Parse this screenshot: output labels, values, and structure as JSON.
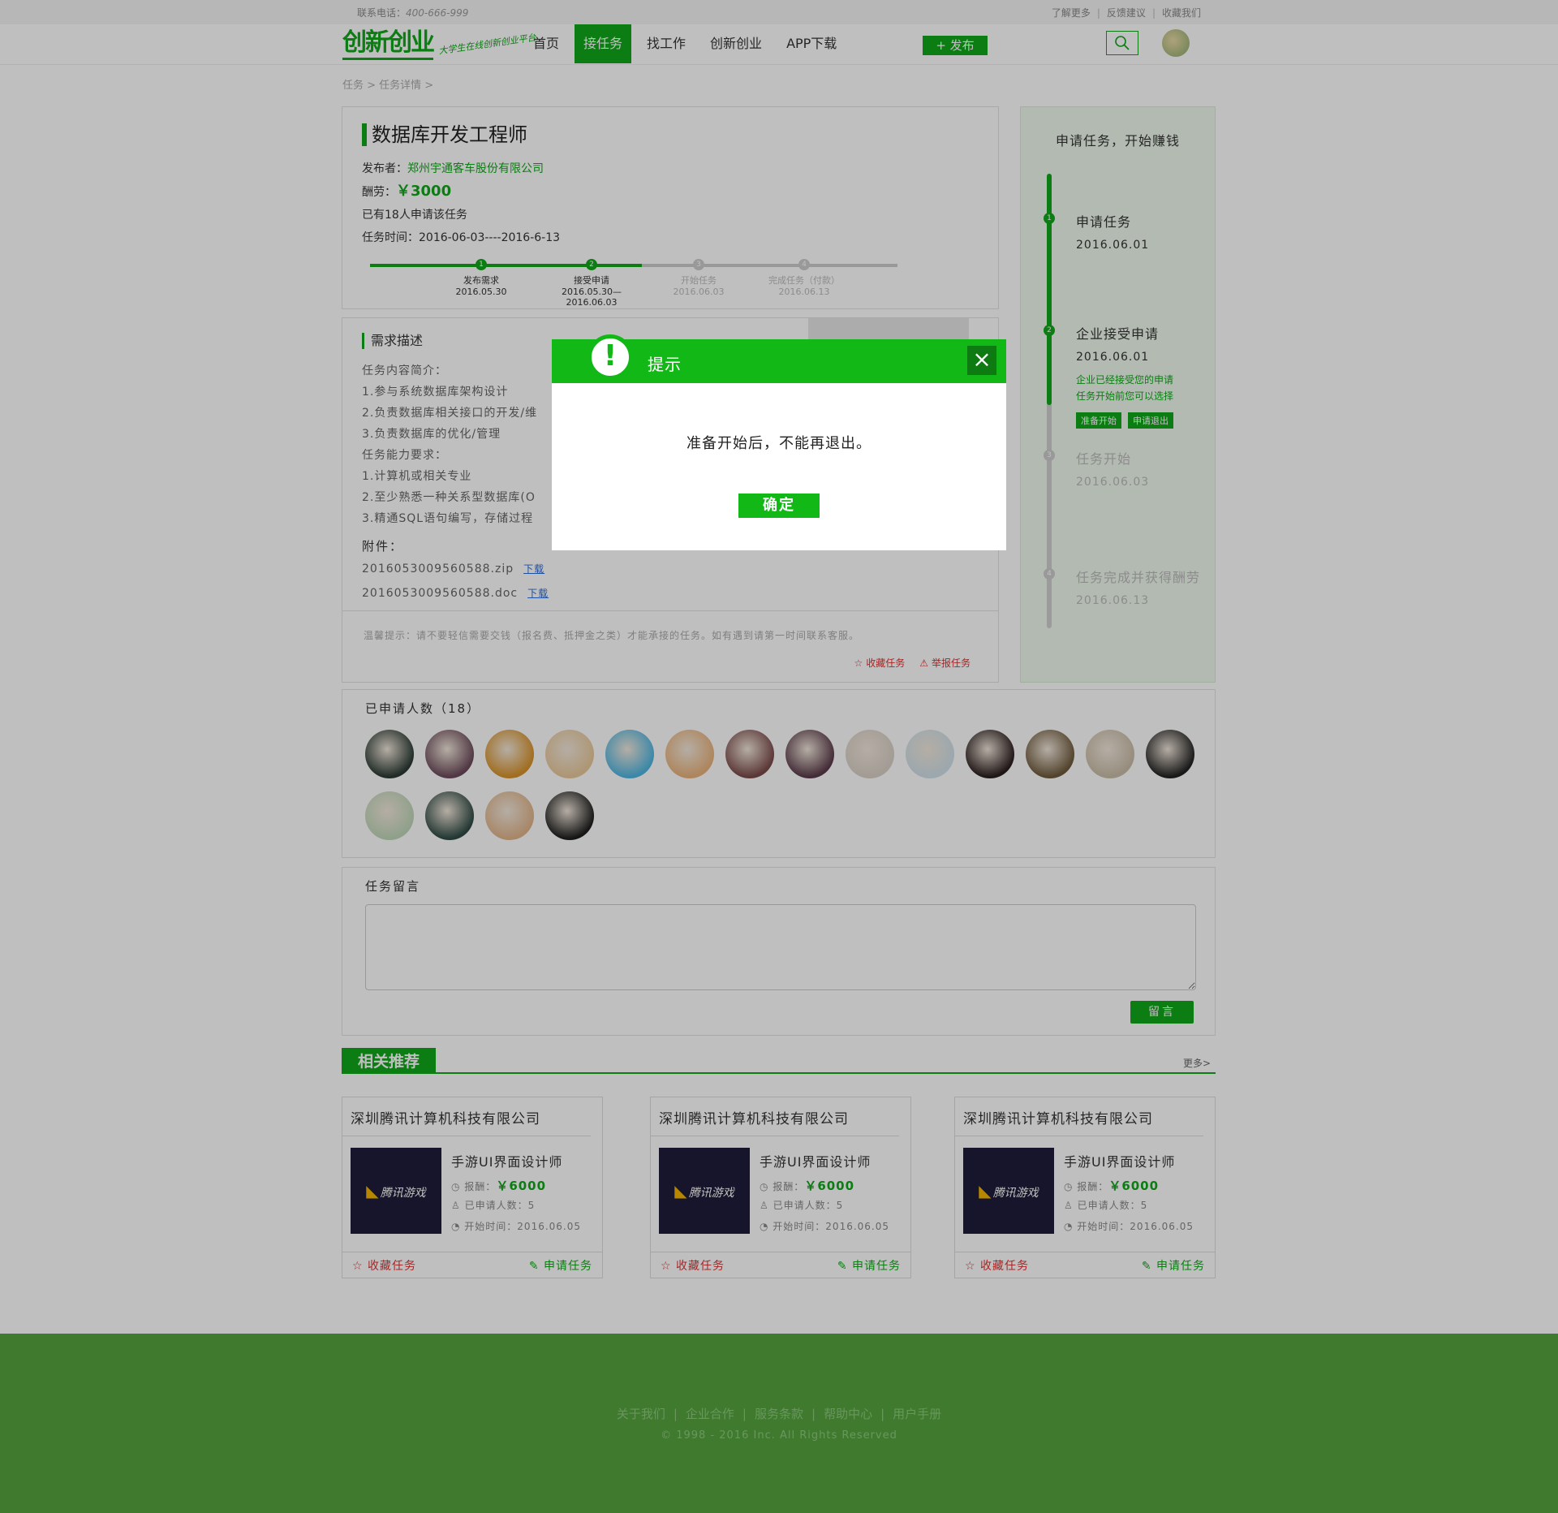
{
  "topbar": {
    "phone_label": "联系电话：",
    "phone": "400-666-999",
    "links": [
      "了解更多",
      "反馈建议",
      "收藏我们"
    ]
  },
  "header": {
    "logo_text": "创新创业",
    "logo_slogan": "大学生在线创新创业平台",
    "nav": [
      "首页",
      "接任务",
      "找工作",
      "创新创业",
      "APP下载"
    ],
    "active_nav": "接任务",
    "publish_label": "+ 发布"
  },
  "breadcrumb": "任务 > 任务详情 >",
  "task": {
    "title": "数据库开发工程师",
    "publisher_label": "发布者：",
    "publisher": "郑州宇通客车股份有限公司",
    "reward_label": "酬劳：",
    "reward": "￥3000",
    "applicants_text": "已有18人申请该任务",
    "time_label": "任务时间：",
    "time_range": "2016-06-03----2016-6-13",
    "progress": [
      {
        "num": "1",
        "name": "发布需求",
        "date": "2016.05.30"
      },
      {
        "num": "2",
        "name": "接受申请",
        "date": "2016.05.30—2016.06.03"
      },
      {
        "num": "3",
        "name": "开始任务",
        "date": "2016.06.03"
      },
      {
        "num": "4",
        "name": "完成任务（付款）",
        "date": "2016.06.13"
      }
    ],
    "progress_done_fraction": 0.5
  },
  "description": {
    "title": "需求描述",
    "lines": [
      "任务内容简介：",
      "1.参与系统数据库架构设计",
      "2.负责数据库相关接口的开发/维",
      "3.负责数据库的优化/管理",
      "任务能力要求：",
      "1.计算机或相关专业",
      "2.至少熟悉一种关系型数据库(O",
      "3.精通SQL语句编写，存储过程"
    ],
    "attachments_title": "附件：",
    "attachments": [
      {
        "name": "2016053009560588.zip",
        "link": "下载"
      },
      {
        "name": "2016053009560588.doc",
        "link": "下载"
      }
    ],
    "tip": "温馨提示：请不要轻信需要交钱（报名费、抵押金之类）才能承接的任务。如有遇到请第一时间联系客服。",
    "fav_label": "收藏任务",
    "report_label": "举报任务"
  },
  "steps_panel": {
    "title": "申请任务，开始赚钱",
    "steps": [
      {
        "num": "1",
        "name": "申请任务",
        "date": "2016.06.01"
      },
      {
        "num": "2",
        "name": "企业接受申请",
        "date": "2016.06.01",
        "note1": "企业已经接受您的申请",
        "note2": "任务开始前您可以选择",
        "btn1": "准备开始",
        "btn2": "申请退出"
      },
      {
        "num": "3",
        "name": "任务开始",
        "date": "2016.06.03"
      },
      {
        "num": "4",
        "name": "任务完成并获得酬劳",
        "date": "2016.06.13"
      }
    ]
  },
  "applicants": {
    "title": "已申请人数（18）",
    "avatar_colors": [
      "#2b3a34",
      "#6b4a5a",
      "#d7922b",
      "#e8c89a",
      "#4fb5e0",
      "#e8b27b",
      "#7a4a4a",
      "#5a3b4a",
      "#d9d0c6",
      "#cfe0e8",
      "#2a1e1e",
      "#6e5a3c",
      "#c9bca8",
      "#222222",
      "#bfd6b8",
      "#2f4a44",
      "#e0b48a",
      "#1e1e1e"
    ]
  },
  "comment": {
    "title": "任务留言",
    "button": "留言"
  },
  "related": {
    "title": "相关推荐",
    "more": "更多>",
    "cards": [
      {
        "company": "深圳腾讯计算机科技有限公司",
        "job": "手游UI界面设计师",
        "reward_label": "报酬：",
        "reward": "￥6000",
        "applicants": "已申请人数：5",
        "start": "开始时间：2016.06.05",
        "img_text": "腾讯游戏",
        "fav": "收藏任务",
        "apply": "申请任务"
      },
      {
        "company": "深圳腾讯计算机科技有限公司",
        "job": "手游UI界面设计师",
        "reward_label": "报酬：",
        "reward": "￥6000",
        "applicants": "已申请人数：5",
        "start": "开始时间：2016.06.05",
        "img_text": "腾讯游戏",
        "fav": "收藏任务",
        "apply": "申请任务"
      },
      {
        "company": "深圳腾讯计算机科技有限公司",
        "job": "手游UI界面设计师",
        "reward_label": "报酬：",
        "reward": "￥6000",
        "applicants": "已申请人数：5",
        "start": "开始时间：2016.06.05",
        "img_text": "腾讯游戏",
        "fav": "收藏任务",
        "apply": "申请任务"
      }
    ]
  },
  "footer": {
    "links": [
      "关于我们",
      "企业合作",
      "服务条款",
      "帮助中心",
      "用户手册"
    ],
    "copyright": "© 1998 - 2016  Inc. All Rights Reserved"
  },
  "dialog": {
    "title": "提示",
    "message": "准备开始后，不能再退出。",
    "ok": "确定",
    "close_icon": "close-icon",
    "alert_icon": "exclamation-icon"
  },
  "colors": {
    "brand_green": "#11a71a",
    "footer_green": "#54a33f",
    "dialog_green": "#11b816"
  }
}
